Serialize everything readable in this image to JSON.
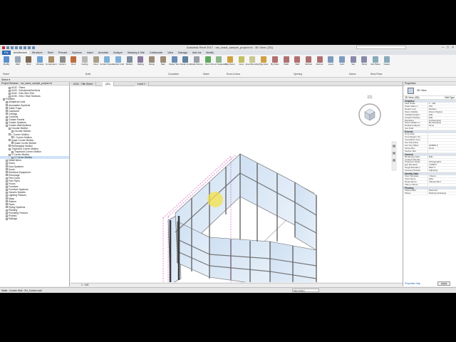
{
  "title": "Autodesk Revit 2017 - rac_basic_sample_project.rvt - 3D View: {3D}",
  "tabs": [
    "File",
    "Architecture",
    "Structure",
    "Steel",
    "Precast",
    "Systems",
    "Insert",
    "Annotate",
    "Analyze",
    "Massing & Site",
    "Collaborate",
    "View",
    "Manage",
    "Add-Ins",
    "Modify"
  ],
  "ribbon": {
    "buttons": [
      "Modify",
      "Wall",
      "Door",
      "Window",
      "Component",
      "Column",
      "Roof",
      "Ceiling",
      "Floor",
      "Curtain System",
      "Curtain Grid",
      "Mullion",
      "Railing",
      "Ramp",
      "Stair",
      "Model Text",
      "Model Line",
      "Model Group",
      "Room",
      "Room Separator",
      "Tag Room",
      "Area",
      "Area Boundary",
      "Tag Area",
      "By Face",
      "Shaft",
      "Wall",
      "Vertical",
      "Dormer",
      "Level",
      "Grid",
      "Set",
      "Show",
      "Ref Plane",
      "Viewer"
    ],
    "panels": [
      "Select",
      "Build",
      "Circulation",
      "Model",
      "Room & Area",
      "Opening",
      "Datum",
      "Work Plane"
    ]
  },
  "select_label": "Select ▾",
  "browser": {
    "header": "Project Browser - rac_basic_sample_project.rvt",
    "items": [
      {
        "text": "#102 - Plans",
        "indent": 3
      },
      {
        "text": "#103 - Elevations/Sections",
        "indent": 3
      },
      {
        "text": "#104 - Elev./Sec./Det.",
        "indent": 3
      },
      {
        "text": "#105 - Elev./ Stair Sections",
        "indent": 3
      },
      {
        "text": "Families",
        "indent": 1
      },
      {
        "text": "Analytical Links",
        "indent": 2
      },
      {
        "text": "Annotation Symbols",
        "indent": 2
      },
      {
        "text": "Cable Trays",
        "indent": 2
      },
      {
        "text": "Casework",
        "indent": 2
      },
      {
        "text": "Ceilings",
        "indent": 2
      },
      {
        "text": "Conduits",
        "indent": 2
      },
      {
        "text": "Curtain Panels",
        "indent": 2
      },
      {
        "text": "Curtain Systems",
        "indent": 2
      },
      {
        "text": "Curtain Wall Mullions",
        "indent": 2
      },
      {
        "text": "Circular Mullion",
        "indent": 3
      },
      {
        "text": "Circular Mullion",
        "indent": 4
      },
      {
        "text": "L Corner Mullion",
        "indent": 3
      },
      {
        "text": "L Corner Mullion",
        "indent": 4
      },
      {
        "text": "Quad Corner Mullion",
        "indent": 3
      },
      {
        "text": "Quad Corner Mullion",
        "indent": 4
      },
      {
        "text": "Rectangular Mullion",
        "indent": 3
      },
      {
        "text": "Trapezoid Corner Mullion",
        "indent": 3
      },
      {
        "text": "Trapezoid Corner Mullion",
        "indent": 4
      },
      {
        "text": "V Corner Mullion",
        "indent": 3
      },
      {
        "text": "V Corner Mullion",
        "indent": 4,
        "selected": true
      },
      {
        "text": "Detail Items",
        "indent": 2
      },
      {
        "text": "Doors",
        "indent": 2
      },
      {
        "text": "Duct Systems",
        "indent": 2
      },
      {
        "text": "Ducts",
        "indent": 2
      },
      {
        "text": "Electrical Equipment",
        "indent": 2
      },
      {
        "text": "Entourage",
        "indent": 2
      },
      {
        "text": "Flex Ducts",
        "indent": 2
      },
      {
        "text": "Flex Pipes",
        "indent": 2
      },
      {
        "text": "Floors",
        "indent": 2
      },
      {
        "text": "Furniture",
        "indent": 2
      },
      {
        "text": "Furniture Systems",
        "indent": 2
      },
      {
        "text": "Generic Models",
        "indent": 2
      },
      {
        "text": "Lighting Fixtures",
        "indent": 2
      },
      {
        "text": "Mass",
        "indent": 2
      },
      {
        "text": "Pattern",
        "indent": 2
      },
      {
        "text": "Pipes",
        "indent": 2
      },
      {
        "text": "Piping Systems",
        "indent": 2
      },
      {
        "text": "Planting",
        "indent": 2
      },
      {
        "text": "Plumbing Fixtures",
        "indent": 2
      },
      {
        "text": "Profiles",
        "indent": 2
      },
      {
        "text": "Railings",
        "indent": 2
      }
    ]
  },
  "view_tabs": [
    "A101 - Title Sheet",
    "{3D}",
    "Level 1"
  ],
  "view_scale": "1 : 100",
  "properties": {
    "header": "Properties",
    "type": "3D View",
    "instance": "3D View: {3D}",
    "edit_type": "Edit Type",
    "rows": [
      {
        "group": "Graphics"
      },
      {
        "k": "View Scale",
        "v": "1 : 100"
      },
      {
        "k": "Scale Value 1:",
        "v": "100"
      },
      {
        "k": "Detail Level",
        "v": "Medium"
      },
      {
        "k": "Parts Visibility",
        "v": "Show Original"
      },
      {
        "k": "Visibility/Graphi...",
        "v": "Edit..."
      },
      {
        "k": "Graphic Display...",
        "v": "Edit..."
      },
      {
        "k": "Discipline",
        "v": "Architectural"
      },
      {
        "k": "Show Hidden Li...",
        "v": "By Discipline"
      },
      {
        "k": "Default Analysis...",
        "v": "None"
      },
      {
        "k": "Sun Path",
        "v": ""
      },
      {
        "group": "Extents"
      },
      {
        "k": "Crop View",
        "v": ""
      },
      {
        "k": "Crop Region Vis...",
        "v": ""
      },
      {
        "k": "Annotation Crop",
        "v": ""
      },
      {
        "k": "Far Clip Active",
        "v": ""
      },
      {
        "k": "Far Clip Offset",
        "v": "304800.0"
      },
      {
        "k": "Scope Box",
        "v": "None"
      },
      {
        "k": "Section Box",
        "v": ""
      },
      {
        "group": "Camera"
      },
      {
        "k": "Rendering Setti...",
        "v": "Edit..."
      },
      {
        "k": "Locked Orientat...",
        "v": ""
      },
      {
        "k": "Projection Mode",
        "v": "Orthographic"
      },
      {
        "k": "Eye Elevation",
        "v": "17898.5"
      },
      {
        "k": "Target Elevation",
        "v": "3607.4"
      },
      {
        "k": "Camera Position",
        "v": "Adjusting"
      },
      {
        "group": "Identity Data"
      },
      {
        "k": "View Template",
        "v": "<None>"
      },
      {
        "k": "View Name",
        "v": "{3D}"
      },
      {
        "k": "Dependency",
        "v": "Independent"
      },
      {
        "k": "Title on Sheet",
        "v": ""
      },
      {
        "group": "Phasing"
      },
      {
        "k": "Phase Filter",
        "v": "Show All"
      },
      {
        "k": "Phase",
        "v": "Working Drawings"
      }
    ],
    "help": "Properties help",
    "apply": "Apply"
  },
  "status": {
    "message": "Walls : Curtain Wall : SH_Curtain wall",
    "model": "Main Model"
  }
}
